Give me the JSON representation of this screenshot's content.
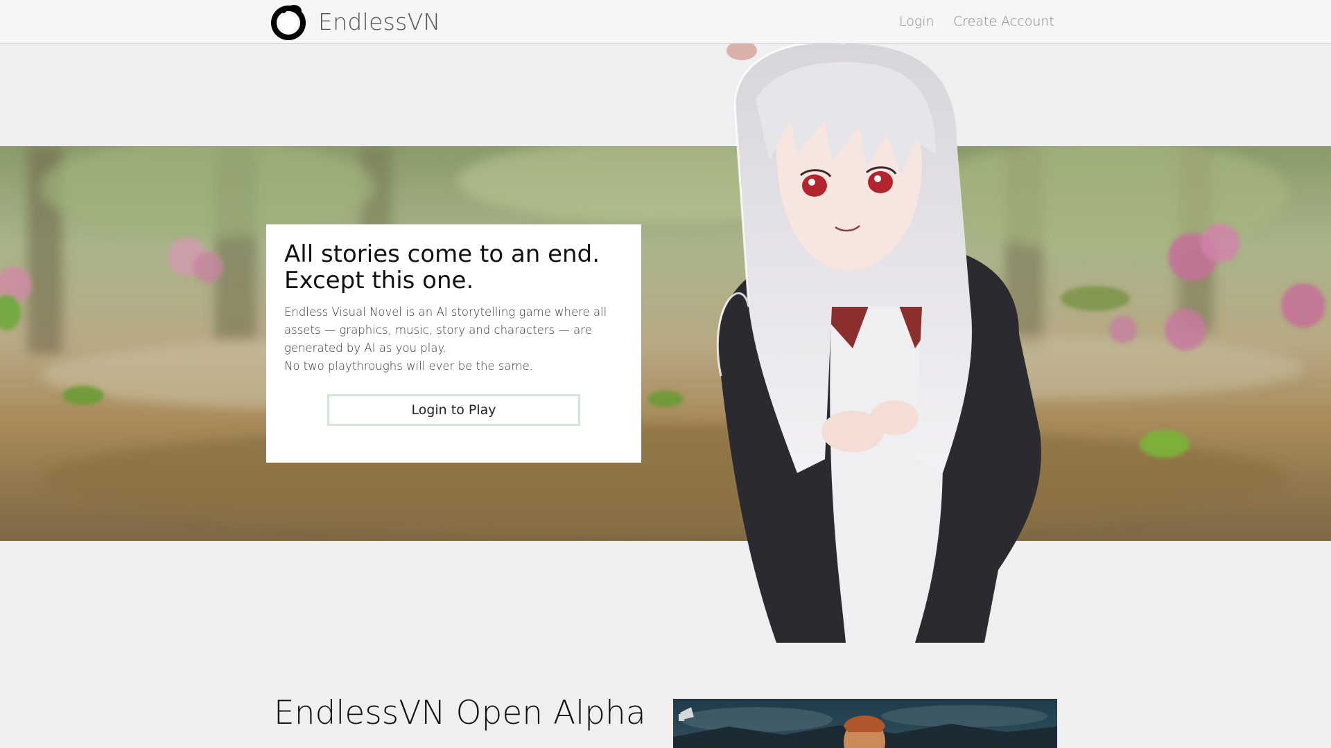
{
  "header": {
    "brand": "EndlessVN",
    "nav": {
      "login": "Login",
      "create_account": "Create Account"
    },
    "logo_icon": "ouroboros-logo-icon"
  },
  "hero": {
    "title_line1": "All stories come to an end.",
    "title_line2": "Except this one.",
    "description": [
      "Endless Visual Novel is an AI storytelling game where all assets — graphics, music, story and characters — are generated by AI as you play.",
      "No two playthroughs will ever be the same."
    ],
    "cta_label": "Login to Play"
  },
  "section": {
    "title": "EndlessVN Open Alpha"
  },
  "colors": {
    "page_bg": "#efefef",
    "header_bg": "#f5f5f5",
    "button_border": "#d3e3d7",
    "nav_text": "#888888"
  }
}
